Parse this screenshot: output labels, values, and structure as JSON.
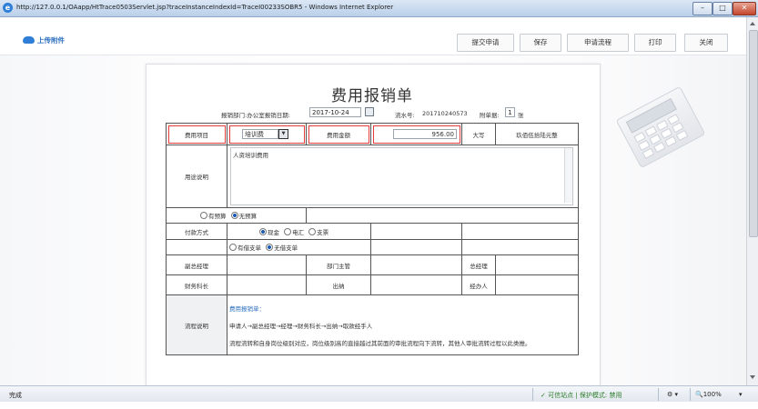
{
  "window": {
    "title": "http://127.0.0.1/OAapp/HtTrace0503Servlet.jsp?traceInstanceIndexId=TraceI00233SOBR5 - Windows Internet Explorer",
    "controls": [
      "–",
      "□",
      "✕"
    ]
  },
  "toolbar": {
    "upload_label": "上传附件",
    "buttons": [
      "提交申请",
      "保存",
      "申请流程",
      "打印",
      "关闭"
    ]
  },
  "form": {
    "title": "费用报销单",
    "dept_text": "报销部门:办公室报销日期:",
    "date_value": "2017-10-24",
    "serial_label": "流水号:",
    "serial_value": "201710240573",
    "attach_label": "附单据:",
    "attach_count": "1",
    "attach_unit": "张",
    "row1": {
      "item_label": "费用项目",
      "item_value": "培训费",
      "amount_label": "费用金额",
      "amount_value": "956.00",
      "upper_label": "大写",
      "upper_value": "玖佰伍拾陆元整"
    },
    "purpose": {
      "label": "用途说明",
      "value": "人资培训费用"
    },
    "budget": {
      "opt1": "有预算",
      "opt2": "无预算"
    },
    "payment": {
      "label": "付款方式",
      "opt1": "现金",
      "opt2": "电汇",
      "opt3": "支票"
    },
    "loan": {
      "opt1": "有借支单",
      "opt2": "无借支单"
    },
    "approvals": {
      "vice_gm": "副总经理",
      "dept_head": "部门主管",
      "gm": "总经理",
      "finance": "财务科长",
      "cashier": "出纳",
      "handler": "经办人"
    },
    "flow": {
      "label": "流程说明",
      "heading": "费用报销单：",
      "line1": "申请人→副总经理→经理→财务科长→出纳→取款经手人",
      "line2": "流程流转和自身岗位级别对应，岗位级别高的直接越过其前面的审批流程向下流转，其他人审批流转过程以此类推。"
    }
  },
  "status": {
    "left": "完成",
    "zone": "✓ 可信站点 | 保护模式: 禁用",
    "zoom": "100%"
  }
}
